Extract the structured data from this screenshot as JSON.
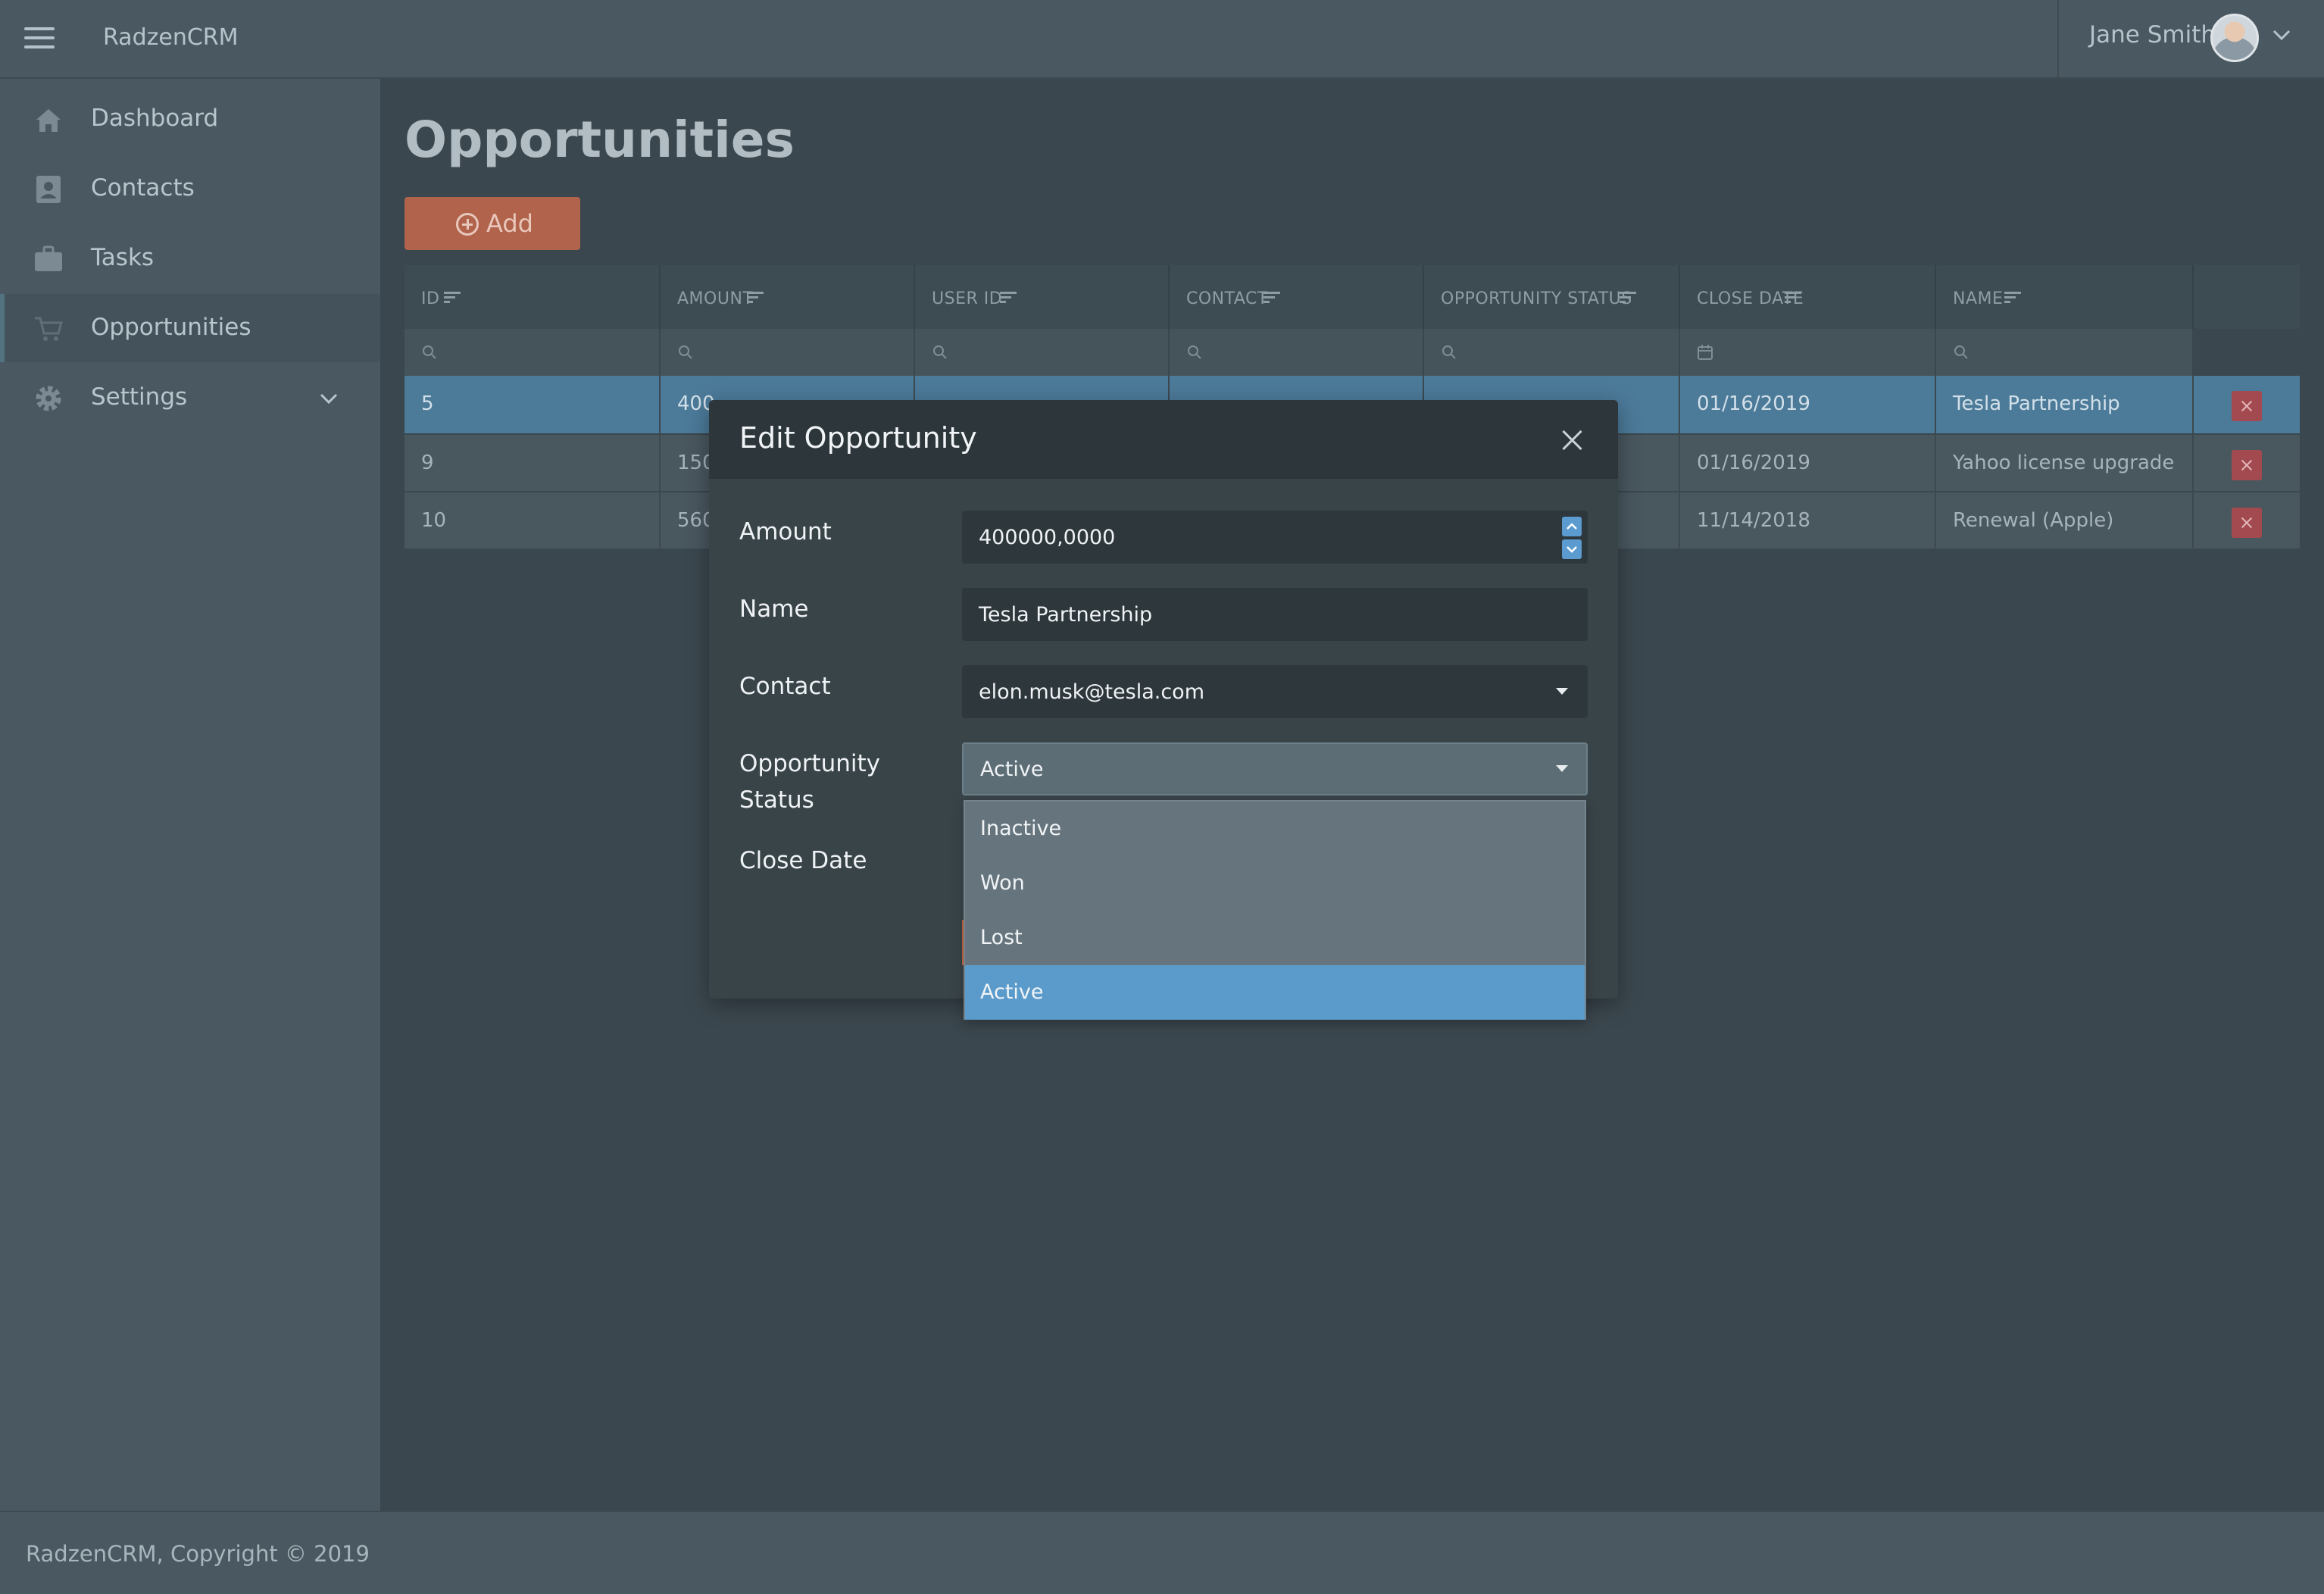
{
  "app": {
    "name": "RadzenCRM"
  },
  "header": {
    "user_name": "Jane Smith"
  },
  "sidebar": {
    "items": [
      {
        "label": "Dashboard",
        "icon": "home-icon"
      },
      {
        "label": "Contacts",
        "icon": "contact-icon"
      },
      {
        "label": "Tasks",
        "icon": "briefcase-icon"
      },
      {
        "label": "Opportunities",
        "icon": "cart-icon",
        "active": true
      },
      {
        "label": "Settings",
        "icon": "gear-icon",
        "expandable": true
      }
    ]
  },
  "page": {
    "title": "Opportunities",
    "add_label": "Add"
  },
  "grid": {
    "columns": [
      "ID",
      "AMOUNT",
      "USER ID",
      "CONTACT",
      "OPPORTUNITY STATUS",
      "CLOSE DATE",
      "NAME"
    ],
    "rows": [
      {
        "id": "5",
        "amount": "400",
        "close_date": "01/16/2019",
        "name": "Tesla Partnership",
        "selected": true
      },
      {
        "id": "9",
        "amount": "150",
        "close_date": "01/16/2019",
        "name": "Yahoo license upgrade"
      },
      {
        "id": "10",
        "amount": "560",
        "close_date": "11/14/2018",
        "name": "Renewal (Apple)"
      }
    ]
  },
  "dialog": {
    "title": "Edit Opportunity",
    "labels": {
      "amount": "Amount",
      "name": "Name",
      "contact": "Contact",
      "status_line1": "Opportunity",
      "status_line2": "Status",
      "close_date": "Close Date"
    },
    "values": {
      "amount": "400000,0000",
      "name": "Tesla Partnership",
      "contact": "elon.musk@tesla.com",
      "status": "Active"
    }
  },
  "status_dropdown": {
    "options": [
      "Inactive",
      "Won",
      "Lost",
      "Active"
    ],
    "selected": "Active"
  },
  "footer": {
    "text": "RadzenCRM, Copyright © 2019"
  },
  "colors": {
    "accent": "#5b9bcb",
    "add_button": "#b1634b",
    "delete_button": "#a24a4f",
    "selected_row": "#4c7a99"
  }
}
